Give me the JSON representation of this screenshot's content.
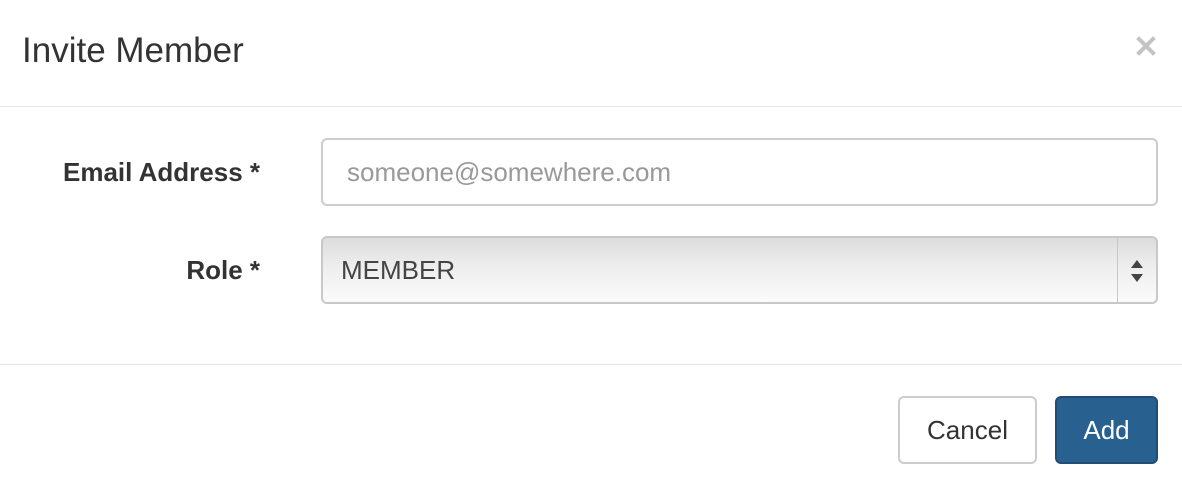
{
  "dialog": {
    "title": "Invite Member",
    "close_icon": "close-icon"
  },
  "form": {
    "email": {
      "label": "Email Address *",
      "value": "",
      "placeholder": "someone@somewhere.com"
    },
    "role": {
      "label": "Role *",
      "selected": "MEMBER",
      "icon": "select-arrows-icon"
    }
  },
  "footer": {
    "cancel_label": "Cancel",
    "add_label": "Add"
  },
  "colors": {
    "primary": "#286090",
    "primary_border": "#204d74",
    "border": "#cccccc",
    "divider": "#e5e5e5",
    "text": "#333333",
    "placeholder": "#999999"
  }
}
